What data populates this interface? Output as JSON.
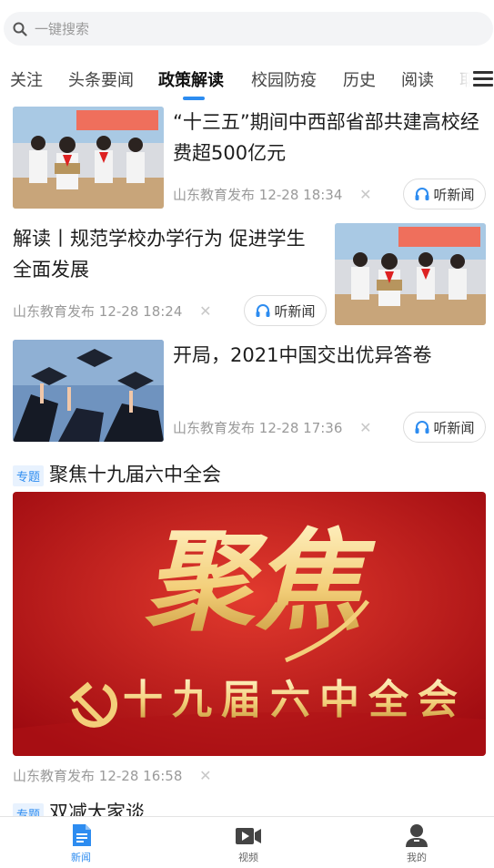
{
  "search": {
    "placeholder": "一键搜索"
  },
  "tabs": [
    {
      "label": "关注"
    },
    {
      "label": "头条要闻"
    },
    {
      "label": "政策解读",
      "active": true
    },
    {
      "label": "校园防疫"
    },
    {
      "label": "历史"
    },
    {
      "label": "阅读"
    },
    {
      "label": "耶"
    }
  ],
  "articles": [
    {
      "title": "“十三五”期间中西部省部共建高校经费超500亿元",
      "source": "山东教育发布",
      "time": "12-28 18:34",
      "listen": "听新闻"
    },
    {
      "title": "解读丨规范学校办学行为 促进学生全面发展",
      "source": "山东教育发布",
      "time": "12-28 18:24",
      "listen": "听新闻"
    },
    {
      "title": "开局，2021中国交出优异答卷",
      "source": "山东教育发布",
      "time": "12-28 17:36",
      "listen": "听新闻"
    }
  ],
  "special": {
    "tag": "专题",
    "title": "聚焦十九届六中全会",
    "banner_big": "聚焦",
    "banner_sub": "十九届六中全会",
    "source": "山东教育发布",
    "time": "12-28 16:58"
  },
  "special2": {
    "tag": "专题",
    "title": "双减大家谈"
  },
  "bottom_nav": [
    {
      "label": "新闻",
      "active": true
    },
    {
      "label": "视频"
    },
    {
      "label": "我的"
    }
  ],
  "colors": {
    "accent": "#2d8cf0",
    "banner_red": "#c8141c",
    "banner_gold": "#f3cf7a"
  }
}
